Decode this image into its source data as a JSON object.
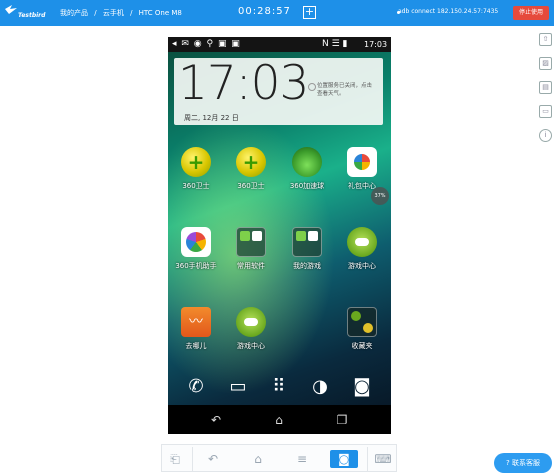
{
  "header": {
    "logo_text": "Testbird",
    "breadcrumbs": [
      "我的产品",
      "/",
      "云手机",
      "/",
      "HTC One M8"
    ],
    "timer": "00:28:57",
    "plus_icon": "plus-icon",
    "adb_text": "adb connect 182.150.24.57:7435",
    "stop_label": "停止使用",
    "colors": {
      "bar": "#1e90e8",
      "stop": "#e64a3c"
    }
  },
  "phone": {
    "status_time": "17:03",
    "clock": "17:03",
    "date": "周二, 12月 22 日",
    "weather_text": "位置服务已关闭，点击查看天气。",
    "badge": "37%",
    "apps": [
      {
        "label": "360卫士",
        "icon": "360-guard-icon"
      },
      {
        "label": "360卫士",
        "icon": "360-guard-icon"
      },
      {
        "label": "360加速球",
        "icon": "speed-ball-icon"
      },
      {
        "label": "礼包中心",
        "icon": "gift-center-icon"
      },
      {
        "label": "360手机助手",
        "icon": "phone-helper-icon"
      },
      {
        "label": "常用软件",
        "icon": "folder-icon"
      },
      {
        "label": "我的游戏",
        "icon": "folder-icon"
      },
      {
        "label": "游戏中心",
        "icon": "game-center-icon"
      },
      {
        "label": "去哪儿",
        "icon": "travel-icon"
      },
      {
        "label": "游戏中心",
        "icon": "game-center-icon"
      },
      {
        "label": "收藏夹",
        "icon": "collection-icon"
      }
    ],
    "dock": [
      "phone-icon",
      "messages-icon",
      "apps-grid-icon",
      "browser-icon",
      "camera-icon"
    ],
    "nav": [
      "back-icon",
      "home-icon",
      "recents-icon"
    ]
  },
  "service_label": "联系客服"
}
